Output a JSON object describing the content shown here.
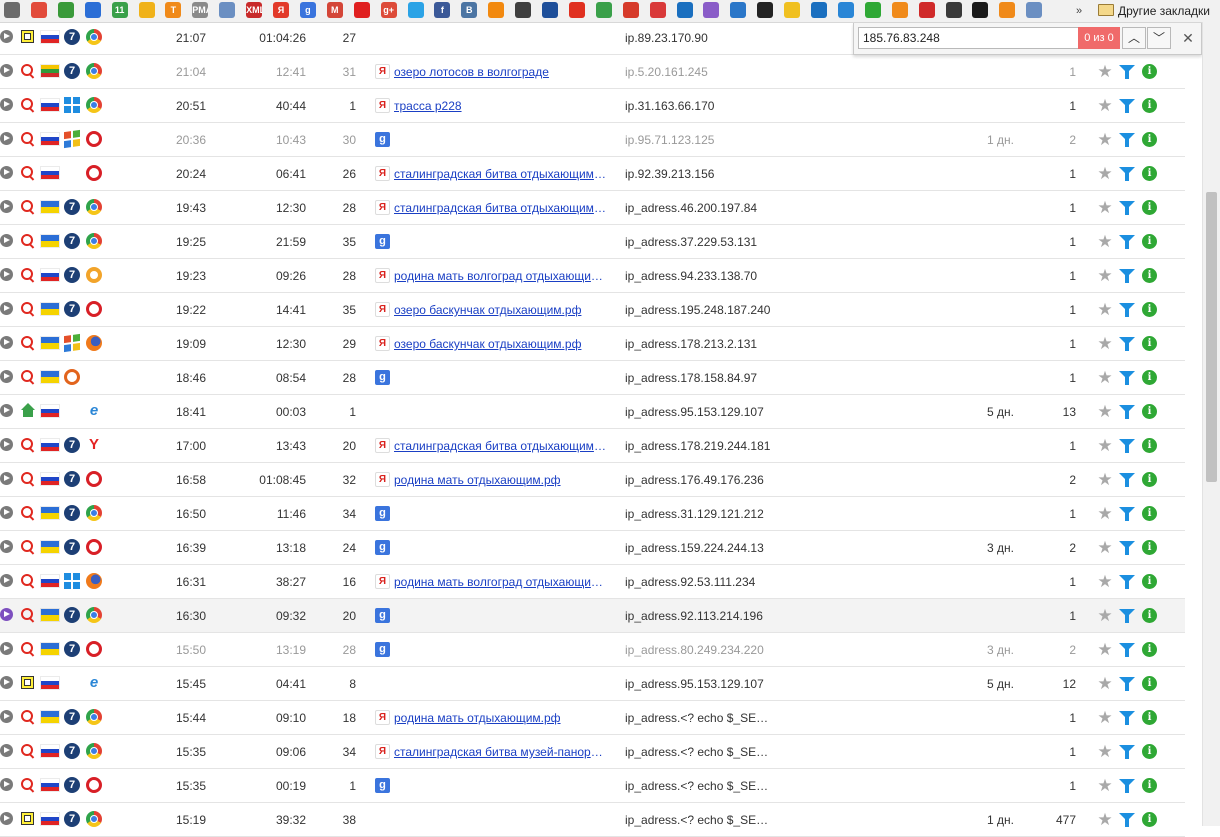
{
  "bookmarks": {
    "items": [
      {
        "icon": "app-grid-icon",
        "text": "",
        "color": "#6b6b6b"
      },
      {
        "icon": "diamond-icon",
        "text": "",
        "color": "#e24b3b"
      },
      {
        "icon": "green-badge-icon",
        "text": "",
        "color": "#3a9a3a"
      },
      {
        "icon": "blue-badge-icon",
        "text": "",
        "color": "#2b6ed6"
      },
      {
        "icon": "number-badge-icon",
        "text": "11",
        "color": "#3aa04a"
      },
      {
        "icon": "pen-icon",
        "text": "",
        "color": "#f0b21a"
      },
      {
        "icon": "t-badge-icon",
        "text": "T",
        "color": "#f08a1a"
      },
      {
        "icon": "pma-icon",
        "text": "PMA",
        "color": "#8a8a8a"
      },
      {
        "icon": "window-icon",
        "text": "",
        "color": "#6b8fc2"
      },
      {
        "icon": "xml-icon",
        "text": "XML",
        "color": "#c82a2a"
      },
      {
        "icon": "yandex-icon",
        "text": "Я",
        "color": "#e23a2a"
      },
      {
        "icon": "google-icon",
        "text": "g",
        "color": "#3a74dd"
      },
      {
        "icon": "gmail-icon",
        "text": "M",
        "color": "#d44638"
      },
      {
        "icon": "youtube-icon",
        "text": "",
        "color": "#e02020"
      },
      {
        "icon": "google-plus-icon",
        "text": "g+",
        "color": "#dd4b39"
      },
      {
        "icon": "twitter-icon",
        "text": "",
        "color": "#2ba3e6"
      },
      {
        "icon": "facebook-icon",
        "text": "f",
        "color": "#3b5998"
      },
      {
        "icon": "vk-icon",
        "text": "B",
        "color": "#4c75a3"
      },
      {
        "icon": "odnoklassniki-icon",
        "text": "",
        "color": "#f2890f"
      },
      {
        "icon": "instagram-icon",
        "text": "",
        "color": "#3f3f3f"
      },
      {
        "icon": "stats-icon",
        "text": "",
        "color": "#1e4f9a"
      },
      {
        "icon": "map-pin-icon",
        "text": "",
        "color": "#e03020"
      },
      {
        "icon": "maps-icon",
        "text": "",
        "color": "#3aa04a"
      },
      {
        "icon": "flag-icon",
        "text": "",
        "color": "#d63a2a"
      },
      {
        "icon": "circle-arrow-icon",
        "text": "",
        "color": "#d93a3a"
      },
      {
        "icon": "globe-icon",
        "text": "",
        "color": "#1a6fbf"
      },
      {
        "icon": "chart-icon",
        "text": "",
        "color": "#8a5cc8"
      },
      {
        "icon": "cloud-icon",
        "text": "",
        "color": "#2a76c8"
      },
      {
        "icon": "sync-icon",
        "text": "",
        "color": "#222222"
      },
      {
        "icon": "task-icon",
        "text": "",
        "color": "#f0c020"
      },
      {
        "icon": "euro-icon",
        "text": "",
        "color": "#1a6fbf"
      },
      {
        "icon": "shield-icon",
        "text": "",
        "color": "#2a86d6"
      },
      {
        "icon": "sber-icon",
        "text": "",
        "color": "#2fa835"
      },
      {
        "icon": "q-icon",
        "text": "",
        "color": "#f08a1a"
      },
      {
        "icon": "bar-chart-icon",
        "text": "",
        "color": "#d02a2a"
      },
      {
        "icon": "phone-icon",
        "text": "",
        "color": "#3a3a3a"
      },
      {
        "icon": "note-icon",
        "text": "",
        "color": "#1a1a1a"
      },
      {
        "icon": "fox-icon",
        "text": "",
        "color": "#f08a1a"
      },
      {
        "icon": "window-icon",
        "text": "",
        "color": "#6b8fc2"
      }
    ],
    "more": "»",
    "folder_label": "Другие закладки"
  },
  "find_bar": {
    "query": "185.76.83.248",
    "count": "0 из 0",
    "prev": "︿",
    "next": "﹀",
    "close": "✕"
  },
  "rows": [
    {
      "src": "box",
      "flag": "ru",
      "os": "win7",
      "browser": "chrome",
      "time": "21:07",
      "duration": "01:04:26",
      "pages": "27",
      "ref": "",
      "query": "",
      "ip": "ip.89.23.170.90",
      "days": "",
      "visits": "",
      "muted": false,
      "hl": false,
      "play": "grey"
    },
    {
      "src": "search",
      "flag": "lt",
      "os": "win7",
      "browser": "chrome",
      "time": "21:04",
      "duration": "12:41",
      "pages": "31",
      "ref": "yandex",
      "query": "озеро лотосов в волгограде",
      "ip": "ip.5.20.161.245",
      "days": "",
      "visits": "1",
      "muted": true,
      "hl": false,
      "play": "grey"
    },
    {
      "src": "search",
      "flag": "ru",
      "os": "win8",
      "browser": "chrome",
      "time": "20:51",
      "duration": "40:44",
      "pages": "1",
      "ref": "yandex",
      "query": "трасса р228",
      "ip": "ip.31.163.66.170",
      "days": "",
      "visits": "1",
      "muted": false,
      "hl": false,
      "play": "grey"
    },
    {
      "src": "search",
      "flag": "ru",
      "os": "winxp",
      "browser": "opera",
      "time": "20:36",
      "duration": "10:43",
      "pages": "30",
      "ref": "google",
      "query": "",
      "ip": "ip.95.71.123.125",
      "days": "1 дн.",
      "visits": "2",
      "muted": true,
      "hl": false,
      "play": "grey"
    },
    {
      "src": "search",
      "flag": "ru",
      "os": "",
      "browser": "opera",
      "time": "20:24",
      "duration": "06:41",
      "pages": "26",
      "ref": "yandex",
      "query": "сталинградская битва отдыхающим.рф",
      "ip": "ip.92.39.213.156",
      "days": "",
      "visits": "1",
      "muted": false,
      "hl": false,
      "play": "grey"
    },
    {
      "src": "search",
      "flag": "ua",
      "os": "win7",
      "browser": "chrome",
      "time": "19:43",
      "duration": "12:30",
      "pages": "28",
      "ref": "yandex",
      "query": "сталинградская битва отдыхающим.рф",
      "ip": "ip_adress.46.200.197.84",
      "days": "",
      "visits": "1",
      "muted": false,
      "hl": false,
      "play": "grey"
    },
    {
      "src": "search",
      "flag": "ua",
      "os": "win7",
      "browser": "chrome",
      "time": "19:25",
      "duration": "21:59",
      "pages": "35",
      "ref": "google",
      "query": "",
      "ip": "ip_adress.37.229.53.131",
      "days": "",
      "visits": "1",
      "muted": false,
      "hl": false,
      "play": "grey"
    },
    {
      "src": "search",
      "flag": "ru",
      "os": "win7",
      "browser": "safari",
      "time": "19:23",
      "duration": "09:26",
      "pages": "28",
      "ref": "yandex",
      "query": "родина мать волгоград отдыхающим.рф",
      "ip": "ip_adress.94.233.138.70",
      "days": "",
      "visits": "1",
      "muted": false,
      "hl": false,
      "play": "grey"
    },
    {
      "src": "search",
      "flag": "ua",
      "os": "win7",
      "browser": "opera",
      "time": "19:22",
      "duration": "14:41",
      "pages": "35",
      "ref": "yandex",
      "query": "озеро баскунчак отдыхающим.рф",
      "ip": "ip_adress.195.248.187.240",
      "days": "",
      "visits": "1",
      "muted": false,
      "hl": false,
      "play": "grey"
    },
    {
      "src": "search",
      "flag": "ua",
      "os": "winxp",
      "browser": "firefox",
      "time": "19:09",
      "duration": "12:30",
      "pages": "29",
      "ref": "yandex",
      "query": "озеро баскунчак отдыхающим.рф",
      "ip": "ip_adress.178.213.2.131",
      "days": "",
      "visits": "1",
      "muted": false,
      "hl": false,
      "play": "grey"
    },
    {
      "src": "search",
      "flag": "ua",
      "os": "ubuntu",
      "browser": "",
      "time": "18:46",
      "duration": "08:54",
      "pages": "28",
      "ref": "google",
      "query": "",
      "ip": "ip_adress.178.158.84.97",
      "days": "",
      "visits": "1",
      "muted": false,
      "hl": false,
      "play": "grey"
    },
    {
      "src": "home",
      "flag": "ru",
      "os": "",
      "browser": "ie",
      "time": "18:41",
      "duration": "00:03",
      "pages": "1",
      "ref": "",
      "query": "",
      "ip": "ip_adress.95.153.129.107",
      "days": "5 дн.",
      "visits": "13",
      "muted": false,
      "hl": false,
      "play": "grey"
    },
    {
      "src": "search",
      "flag": "ru",
      "os": "win7",
      "browser": "yandex",
      "time": "17:00",
      "duration": "13:43",
      "pages": "20",
      "ref": "yandex",
      "query": "сталинградская битва отдыхающим.рф",
      "ip": "ip_adress.178.219.244.181",
      "days": "",
      "visits": "1",
      "muted": false,
      "hl": false,
      "play": "grey"
    },
    {
      "src": "search",
      "flag": "ru",
      "os": "win7",
      "browser": "opera",
      "time": "16:58",
      "duration": "01:08:45",
      "pages": "32",
      "ref": "yandex",
      "query": "родина мать отдыхающим.рф",
      "ip": "ip_adress.176.49.176.236",
      "days": "",
      "visits": "2",
      "muted": false,
      "hl": false,
      "play": "grey"
    },
    {
      "src": "search",
      "flag": "ua",
      "os": "win7",
      "browser": "chrome",
      "time": "16:50",
      "duration": "11:46",
      "pages": "34",
      "ref": "google",
      "query": "",
      "ip": "ip_adress.31.129.121.212",
      "days": "",
      "visits": "1",
      "muted": false,
      "hl": false,
      "play": "grey"
    },
    {
      "src": "search",
      "flag": "ua",
      "os": "win7",
      "browser": "opera",
      "time": "16:39",
      "duration": "13:18",
      "pages": "24",
      "ref": "google",
      "query": "",
      "ip": "ip_adress.159.224.244.13",
      "days": "3 дн.",
      "visits": "2",
      "muted": false,
      "hl": false,
      "play": "grey"
    },
    {
      "src": "search",
      "flag": "ru",
      "os": "win8",
      "browser": "firefox",
      "time": "16:31",
      "duration": "38:27",
      "pages": "16",
      "ref": "yandex",
      "query": "родина мать волгоград отдыхающим.рф",
      "ip": "ip_adress.92.53.111.234",
      "days": "",
      "visits": "1",
      "muted": false,
      "hl": false,
      "play": "grey"
    },
    {
      "src": "search",
      "flag": "ua",
      "os": "win7",
      "browser": "chrome",
      "time": "16:30",
      "duration": "09:32",
      "pages": "20",
      "ref": "google",
      "query": "",
      "ip": "ip_adress.92.113.214.196",
      "days": "",
      "visits": "1",
      "muted": false,
      "hl": true,
      "play": "purple"
    },
    {
      "src": "search",
      "flag": "ua",
      "os": "win7",
      "browser": "opera",
      "time": "15:50",
      "duration": "13:19",
      "pages": "28",
      "ref": "google",
      "query": "",
      "ip": "ip_adress.80.249.234.220",
      "days": "3 дн.",
      "visits": "2",
      "muted": true,
      "hl": false,
      "play": "grey"
    },
    {
      "src": "box",
      "flag": "ru",
      "os": "",
      "browser": "ie",
      "time": "15:45",
      "duration": "04:41",
      "pages": "8",
      "ref": "",
      "query": "",
      "ip": "ip_adress.95.153.129.107",
      "days": "5 дн.",
      "visits": "12",
      "muted": false,
      "hl": false,
      "play": "grey"
    },
    {
      "src": "search",
      "flag": "ua",
      "os": "win7",
      "browser": "chrome",
      "time": "15:44",
      "duration": "09:10",
      "pages": "18",
      "ref": "yandex",
      "query": "родина мать отдыхающим.рф",
      "ip": "ip_adress.<? echo $_SE…",
      "days": "",
      "visits": "1",
      "muted": false,
      "hl": false,
      "play": "grey"
    },
    {
      "src": "search",
      "flag": "ru",
      "os": "win7",
      "browser": "chrome",
      "time": "15:35",
      "duration": "09:06",
      "pages": "34",
      "ref": "yandex",
      "query": "сталинградская битва музей-панорама",
      "ip": "ip_adress.<? echo $_SE…",
      "days": "",
      "visits": "1",
      "muted": false,
      "hl": false,
      "play": "grey"
    },
    {
      "src": "search",
      "flag": "ru",
      "os": "win7",
      "browser": "opera",
      "time": "15:35",
      "duration": "00:19",
      "pages": "1",
      "ref": "google",
      "query": "",
      "ip": "ip_adress.<? echo $_SE…",
      "days": "",
      "visits": "1",
      "muted": false,
      "hl": false,
      "play": "grey"
    },
    {
      "src": "box",
      "flag": "ru",
      "os": "win7",
      "browser": "chrome",
      "time": "15:19",
      "duration": "39:32",
      "pages": "38",
      "ref": "",
      "query": "",
      "ip": "ip_adress.<? echo $_SE…",
      "days": "1 дн.",
      "visits": "477",
      "muted": false,
      "hl": false,
      "play": "grey"
    }
  ]
}
